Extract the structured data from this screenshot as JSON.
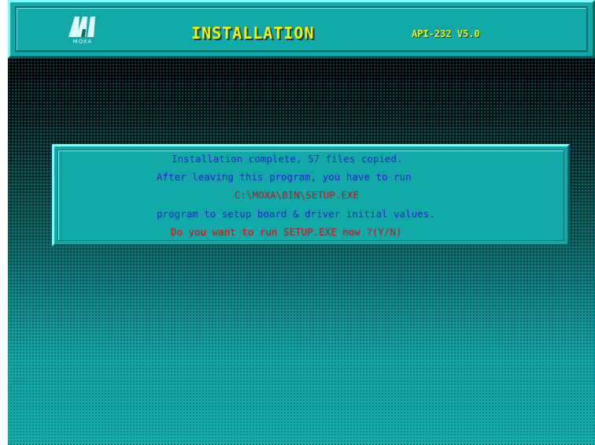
{
  "header": {
    "logo_text": "MOXA",
    "title": "INSTALLATION",
    "version": "API-232 V5.0"
  },
  "dialog": {
    "line1": "Installation complete, 57 files copied.",
    "line2": "After leaving this program, you have to run",
    "line3": "C:\\MOXA\\BIN\\SETUP.EXE",
    "line4": "program to setup board & driver initial values.",
    "line5": "Do you want to run SETUP.EXE now ?(Y/N)"
  },
  "colors": {
    "panel": "#11a8a8",
    "text_blue": "#2222cc",
    "text_red": "#cc1111",
    "title_yellow": "#f4f400"
  }
}
